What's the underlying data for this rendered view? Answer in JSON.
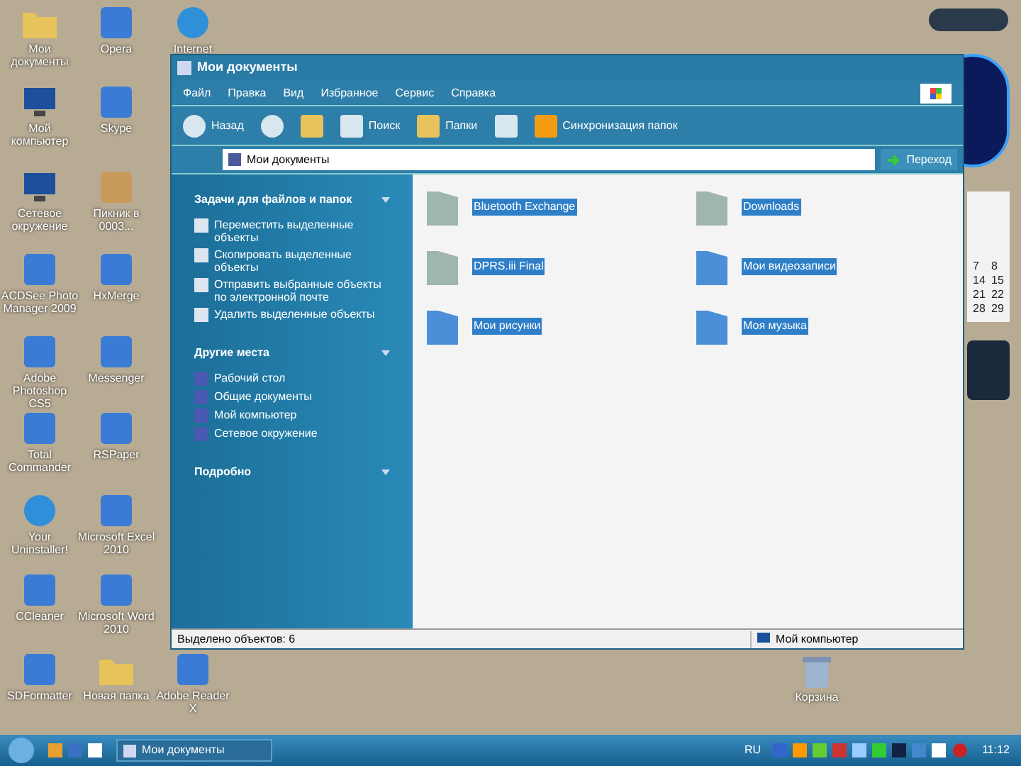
{
  "desktop_icons": [
    {
      "label": "Мои документы",
      "kind": "folder"
    },
    {
      "label": "Opera",
      "kind": "app"
    },
    {
      "label": "Internet",
      "kind": "globe"
    },
    {
      "label": "Мой компьютер",
      "kind": "monitor"
    },
    {
      "label": "Skype",
      "kind": "app"
    },
    {
      "label": "Сетевое окружение",
      "kind": "monitor"
    },
    {
      "label": "Пикник в 0003...",
      "kind": "image"
    },
    {
      "label": "ACDSee Photo Manager 2009",
      "kind": "app"
    },
    {
      "label": "HxMerge",
      "kind": "app"
    },
    {
      "label": "Adobe Photoshop CS5",
      "kind": "app"
    },
    {
      "label": "Messenger",
      "kind": "app"
    },
    {
      "label": "Total Commander",
      "kind": "app"
    },
    {
      "label": "RSPaper",
      "kind": "app"
    },
    {
      "label": "Your Uninstaller!",
      "kind": "globe"
    },
    {
      "label": "Microsoft Excel 2010",
      "kind": "app"
    },
    {
      "label": "CCleaner",
      "kind": "app"
    },
    {
      "label": "Microsoft Word 2010",
      "kind": "app"
    },
    {
      "label": "SDFormatter",
      "kind": "app"
    },
    {
      "label": "Новая папка",
      "kind": "folder"
    },
    {
      "label": "Adobe Reader X",
      "kind": "app"
    }
  ],
  "recycle_bin": {
    "label": "Корзина"
  },
  "calendar_gadget": {
    "days": [
      "7",
      "8",
      "14",
      "15",
      "21",
      "22",
      "28",
      "29"
    ]
  },
  "window": {
    "title": "Мои документы",
    "menu": [
      "Файл",
      "Правка",
      "Вид",
      "Избранное",
      "Сервис",
      "Справка"
    ],
    "toolbar": [
      {
        "label": "Назад",
        "kind": "back"
      },
      {
        "kind": "forward"
      },
      {
        "kind": "up"
      },
      {
        "label": "Поиск",
        "kind": "search"
      },
      {
        "label": "Папки",
        "kind": "folders"
      },
      {
        "kind": "views"
      },
      {
        "label": "Синхронизация папок",
        "kind": "sync"
      }
    ],
    "address": {
      "value": "Мои документы",
      "go": "Переход"
    },
    "panels": [
      {
        "title": "Задачи для файлов и папок",
        "items": [
          "Переместить выделенные объекты",
          "Скопировать выделенные объекты",
          "Отправить выбранные объекты по электронной почте",
          "Удалить выделенные объекты"
        ]
      },
      {
        "title": "Другие места",
        "items": [
          "Рабочий стол",
          "Общие документы",
          "Мой компьютер",
          "Сетевое окружение"
        ]
      },
      {
        "title": "Подробно"
      }
    ],
    "files": [
      {
        "name": "Bluetooth Exchange",
        "selected": true,
        "kind": "plain"
      },
      {
        "name": "Downloads",
        "selected": true,
        "kind": "plain"
      },
      {
        "name": "DPRS.iii Final",
        "selected": true,
        "kind": "plain"
      },
      {
        "name": "Мои видеозаписи",
        "selected": true,
        "kind": "special"
      },
      {
        "name": "Мои рисунки",
        "selected": true,
        "kind": "special"
      },
      {
        "name": "Моя музыка",
        "selected": true,
        "kind": "special"
      }
    ],
    "status": {
      "left": "Выделено объектов: 6",
      "right": "Мой компьютер"
    }
  },
  "taskbar": {
    "task": "Мои документы",
    "lang": "RU",
    "clock": "11:12"
  }
}
